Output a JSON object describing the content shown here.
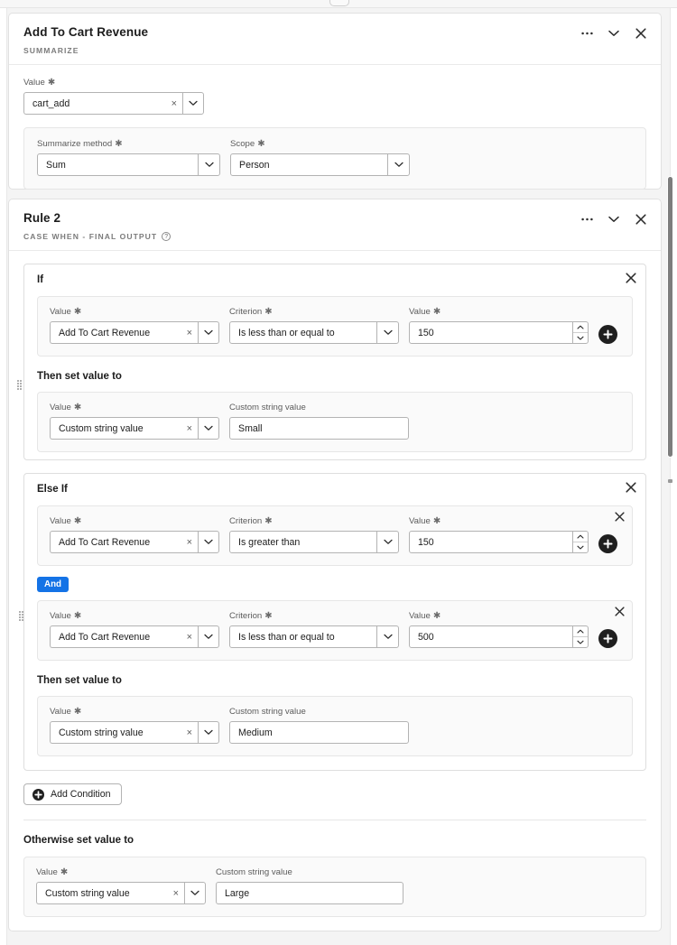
{
  "window": {
    "handle": "drag-handle"
  },
  "cards": [
    {
      "title": "Add To Cart Revenue",
      "subtitle": "SUMMARIZE",
      "actions": {
        "more": "…",
        "collapse": "chevron-down",
        "close": "close"
      },
      "value_label": "Value",
      "value": "cart_add",
      "summarize_label": "Summarize method",
      "summarize_value": "Sum",
      "scope_label": "Scope",
      "scope_value": "Person"
    }
  ],
  "rule": {
    "title": "Rule 2",
    "subtitle": "CASE WHEN - FINAL OUTPUT",
    "help_icon": "?",
    "actions": {
      "more": "…",
      "collapse": "chevron-down",
      "close": "close"
    },
    "if_block": {
      "heading": "If",
      "conditions": [
        {
          "value_label": "Value",
          "value": "Add To Cart Revenue",
          "criterion_label": "Criterion",
          "criterion": "Is less than or equal to",
          "number_label": "Value",
          "number": "150"
        }
      ],
      "then_heading": "Then set value to",
      "then": {
        "value_label": "Value",
        "value": "Custom string value",
        "custom_label": "Custom string value",
        "custom": "Small"
      }
    },
    "elseif_block": {
      "heading": "Else If",
      "operator": "And",
      "conditions": [
        {
          "value_label": "Value",
          "value": "Add To Cart Revenue",
          "criterion_label": "Criterion",
          "criterion": "Is greater than",
          "number_label": "Value",
          "number": "150"
        },
        {
          "value_label": "Value",
          "value": "Add To Cart Revenue",
          "criterion_label": "Criterion",
          "criterion": "Is less than or equal to",
          "number_label": "Value",
          "number": "500"
        }
      ],
      "then_heading": "Then set value to",
      "then": {
        "value_label": "Value",
        "value": "Custom string value",
        "custom_label": "Custom string value",
        "custom": "Medium"
      }
    },
    "add_condition_label": "Add Condition",
    "otherwise_heading": "Otherwise set value to",
    "otherwise": {
      "value_label": "Value",
      "value": "Custom string value",
      "custom_label": "Custom string value",
      "custom": "Large"
    }
  },
  "colors": {
    "accent_blue": "#1473e6",
    "dark_button": "#1f1f1f",
    "border": "#b3b3b3",
    "panel_bg": "#fafafa"
  },
  "clear_glyph": "×"
}
